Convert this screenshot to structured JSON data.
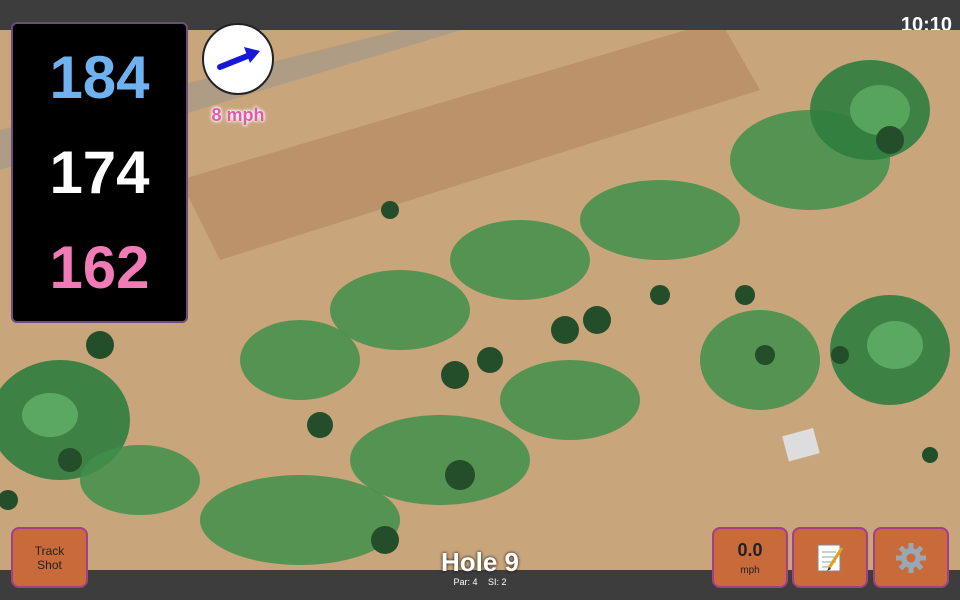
{
  "status": {
    "time": "10:10"
  },
  "yardage": {
    "back": "184",
    "middle": "174",
    "front": "162"
  },
  "wind": {
    "speed": "8 mph",
    "icon": "wind-arrow-icon"
  },
  "buttons": {
    "track_shot_line1": "Track",
    "track_shot_line2": "Shot",
    "speed_value": "0.0",
    "speed_unit": "mph",
    "notes_icon": "notepad-icon",
    "settings_icon": "gear-icon"
  },
  "hole": {
    "title": "Hole 9",
    "par": "Par: 4",
    "si": "SI: 2"
  },
  "colors": {
    "button_bg": "#c96a3a",
    "back_yardage": "#6fb2f0",
    "front_yardage": "#f07bb6",
    "wind_text": "#e25aa8"
  }
}
